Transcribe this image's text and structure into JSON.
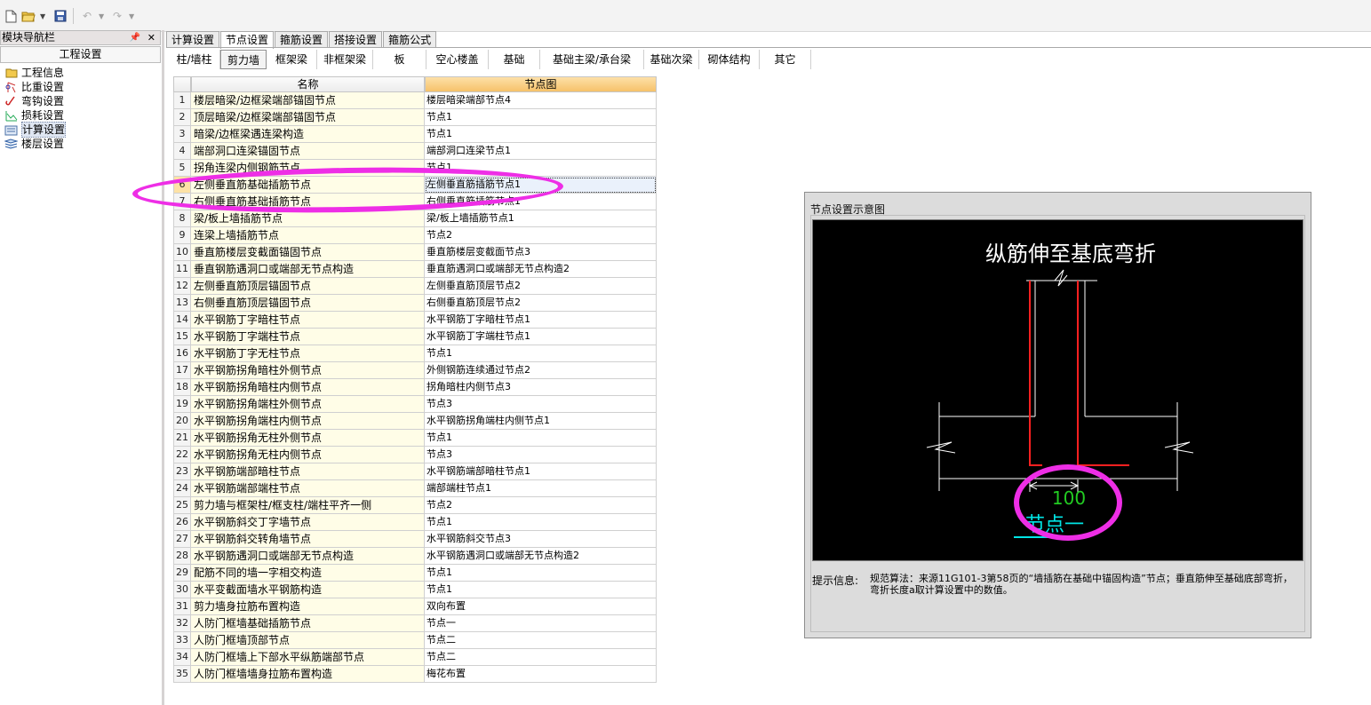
{
  "nav": {
    "title": "模块导航栏",
    "section": "工程设置",
    "items": [
      {
        "label": "工程信息",
        "icon": "folder-info-icon"
      },
      {
        "label": "比重设置",
        "icon": "scale-icon"
      },
      {
        "label": "弯钩设置",
        "icon": "hook-icon"
      },
      {
        "label": "损耗设置",
        "icon": "loss-chart-icon"
      },
      {
        "label": "计算设置",
        "icon": "calculator-icon"
      },
      {
        "label": "楼层设置",
        "icon": "floors-icon"
      }
    ]
  },
  "tabs": [
    "计算设置",
    "节点设置",
    "箍筋设置",
    "搭接设置",
    "箍筋公式"
  ],
  "subtabs": [
    "柱/墙柱",
    "剪力墙",
    "框架梁",
    "非框架梁",
    "板",
    "空心楼盖",
    "基础",
    "基础主梁/承台梁",
    "基础次梁",
    "砌体结构",
    "其它"
  ],
  "grid": {
    "col_name": "名称",
    "col_diagram": "节点图",
    "rows": [
      {
        "num": "1",
        "name": "楼层暗梁/边框梁端部锚固节点",
        "value": "楼层暗梁端部节点4"
      },
      {
        "num": "2",
        "name": "顶层暗梁/边框梁端部锚固节点",
        "value": "节点1"
      },
      {
        "num": "3",
        "name": "暗梁/边框梁遇连梁构造",
        "value": "节点1"
      },
      {
        "num": "4",
        "name": "端部洞口连梁锚固节点",
        "value": "端部洞口连梁节点1"
      },
      {
        "num": "5",
        "name": "拐角连梁内侧钢筋节点",
        "value": "节点1"
      },
      {
        "num": "6",
        "name": "左侧垂直筋基础插筋节点",
        "value": "左侧垂直筋插筋节点1"
      },
      {
        "num": "7",
        "name": "右侧垂直筋基础插筋节点",
        "value": "右侧垂直筋插筋节点1"
      },
      {
        "num": "8",
        "name": "梁/板上墙插筋节点",
        "value": "梁/板上墙插筋节点1"
      },
      {
        "num": "9",
        "name": "连梁上墙插筋节点",
        "value": "节点2"
      },
      {
        "num": "10",
        "name": "垂直筋楼层变截面锚固节点",
        "value": "垂直筋楼层变截面节点3"
      },
      {
        "num": "11",
        "name": "垂直钢筋遇洞口或端部无节点构造",
        "value": "垂直筋遇洞口或端部无节点构造2"
      },
      {
        "num": "12",
        "name": "左侧垂直筋顶层锚固节点",
        "value": "左侧垂直筋顶层节点2"
      },
      {
        "num": "13",
        "name": "右侧垂直筋顶层锚固节点",
        "value": "右侧垂直筋顶层节点2"
      },
      {
        "num": "14",
        "name": "水平钢筋丁字暗柱节点",
        "value": "水平钢筋丁字暗柱节点1"
      },
      {
        "num": "15",
        "name": "水平钢筋丁字端柱节点",
        "value": "水平钢筋丁字端柱节点1"
      },
      {
        "num": "16",
        "name": "水平钢筋丁字无柱节点",
        "value": "节点1"
      },
      {
        "num": "17",
        "name": "水平钢筋拐角暗柱外侧节点",
        "value": "外侧钢筋连续通过节点2"
      },
      {
        "num": "18",
        "name": "水平钢筋拐角暗柱内侧节点",
        "value": "拐角暗柱内侧节点3"
      },
      {
        "num": "19",
        "name": "水平钢筋拐角端柱外侧节点",
        "value": "节点3"
      },
      {
        "num": "20",
        "name": "水平钢筋拐角端柱内侧节点",
        "value": "水平钢筋拐角端柱内侧节点1"
      },
      {
        "num": "21",
        "name": "水平钢筋拐角无柱外侧节点",
        "value": "节点1"
      },
      {
        "num": "22",
        "name": "水平钢筋拐角无柱内侧节点",
        "value": "节点3"
      },
      {
        "num": "23",
        "name": "水平钢筋端部暗柱节点",
        "value": "水平钢筋端部暗柱节点1"
      },
      {
        "num": "24",
        "name": "水平钢筋端部端柱节点",
        "value": "端部端柱节点1"
      },
      {
        "num": "25",
        "name": "剪力墙与框架柱/框支柱/端柱平齐一侧",
        "value": "节点2"
      },
      {
        "num": "26",
        "name": "水平钢筋斜交丁字墙节点",
        "value": "节点1"
      },
      {
        "num": "27",
        "name": "水平钢筋斜交转角墙节点",
        "value": "水平钢筋斜交节点3"
      },
      {
        "num": "28",
        "name": "水平钢筋遇洞口或端部无节点构造",
        "value": "水平钢筋遇洞口或端部无节点构造2"
      },
      {
        "num": "29",
        "name": "配筋不同的墙一字相交构造",
        "value": "节点1"
      },
      {
        "num": "30",
        "name": "水平变截面墙水平钢筋构造",
        "value": "节点1"
      },
      {
        "num": "31",
        "name": "剪力墙身拉筋布置构造",
        "value": "双向布置"
      },
      {
        "num": "32",
        "name": "人防门框墙基础插筋节点",
        "value": "节点一"
      },
      {
        "num": "33",
        "name": "人防门框墙顶部节点",
        "value": "节点二"
      },
      {
        "num": "34",
        "name": "人防门框墙上下部水平纵筋端部节点",
        "value": "节点二"
      },
      {
        "num": "35",
        "name": "人防门框墙墙身拉筋布置构造",
        "value": "梅花布置"
      }
    ]
  },
  "preview": {
    "title": "节点设置示意图",
    "diagram_title": "纵筋伸至基底弯折",
    "dimension": "100",
    "node_label": "节点一",
    "tip_label": "提示信息:",
    "tip_text": "规范算法：来源11G101-3第58页的“墙插筋在基础中锚固构造”节点；垂直筋伸至基础底部弯折，弯折长度a取计算设置中的数值。",
    "colors": {
      "rebar": "#ff2020",
      "dimension": "#22cc22",
      "node_label": "#00e5e5",
      "outline": "#ffffff",
      "annotation": "#ee2ee6"
    }
  }
}
